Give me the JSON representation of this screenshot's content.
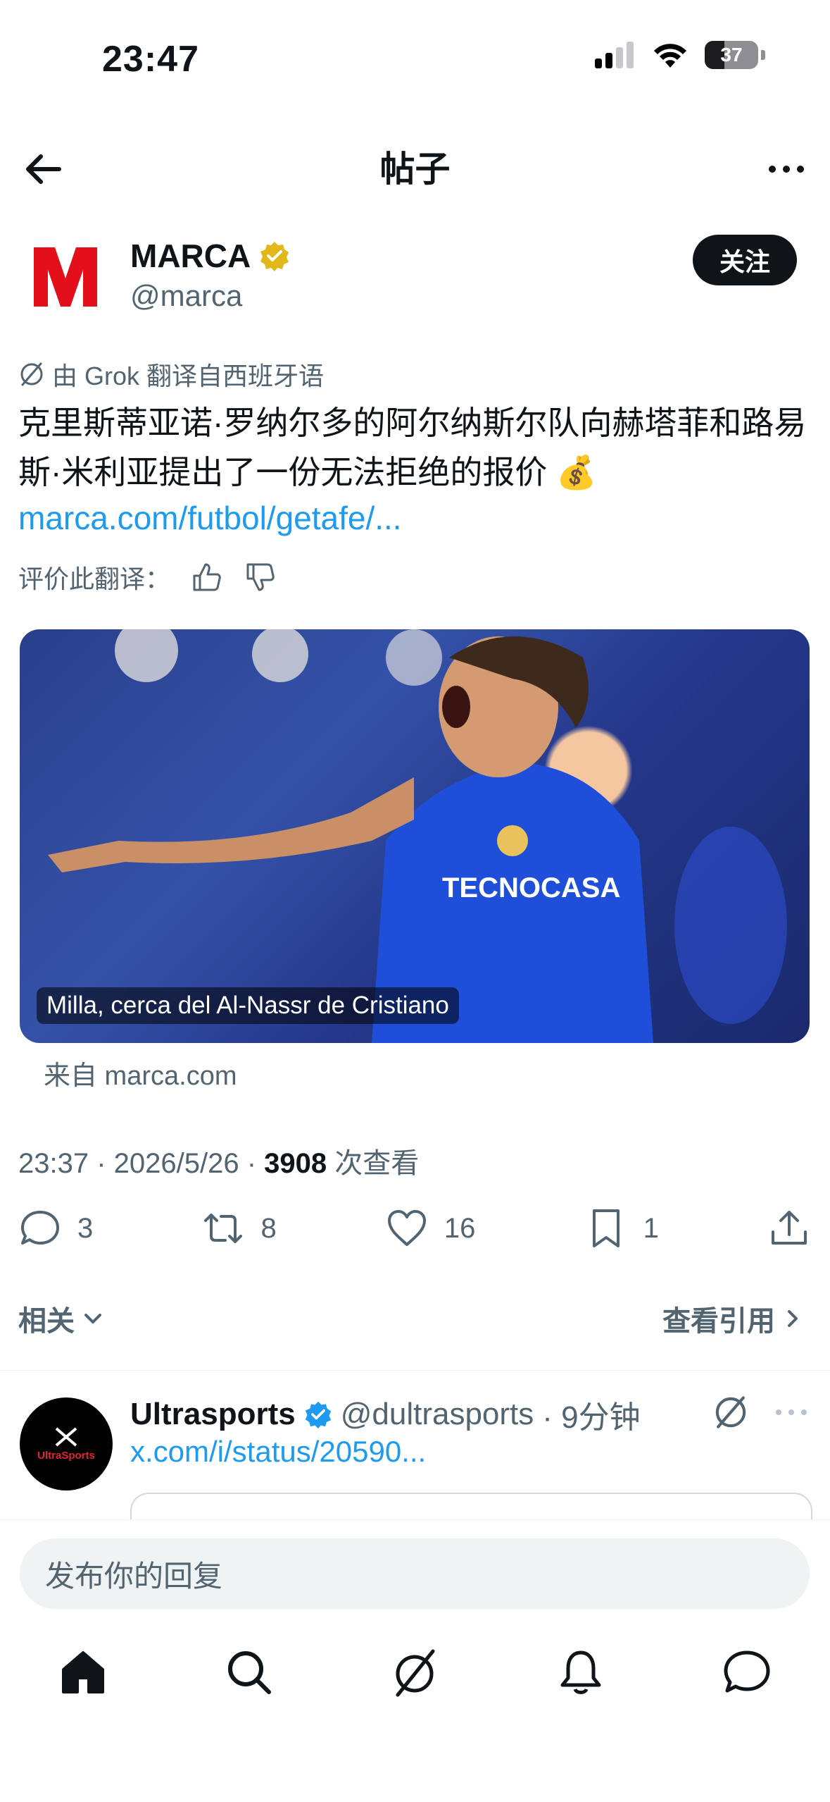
{
  "status_bar": {
    "time": "23:47",
    "battery": "37"
  },
  "header": {
    "title": "帖子"
  },
  "author": {
    "name": "MARCA",
    "handle": "@marca",
    "follow_label": "关注",
    "logo_letter": "M"
  },
  "translation_note": "由 Grok 翻译自西班牙语",
  "tweet": {
    "text": "克里斯蒂亚诺·罗纳尔多的阿尔纳斯尔队向赫塔菲和路易斯·米利亚提出了一份无法拒绝的报价 💰",
    "link": "marca.com/futbol/getafe/...",
    "rate_label": "评价此翻译："
  },
  "media": {
    "caption": "Milla, cerca del Al-Nassr de Cristiano",
    "source": "来自 marca.com"
  },
  "meta": {
    "time_date": "23:37 · 2026/5/26 · ",
    "views": "3908",
    "views_label": " 次查看"
  },
  "actions": {
    "replies": "3",
    "reposts": "8",
    "likes": "16",
    "bookmarks": "1"
  },
  "related_label": "相关",
  "quotes_label": "查看引用",
  "reply_preview": {
    "name": "Ultrasports",
    "handle": "@dultrasports",
    "time": "· 9分钟",
    "link": "x.com/i/status/20590...",
    "avatar_text": "UltraSports"
  },
  "reply_input": {
    "placeholder": "发布你的回复"
  },
  "colors": {
    "accent": "#1d9bf0",
    "text": "#0f1419",
    "muted": "#536471",
    "verified": "#1d9bf0",
    "gold_badge": "#e2b719"
  }
}
